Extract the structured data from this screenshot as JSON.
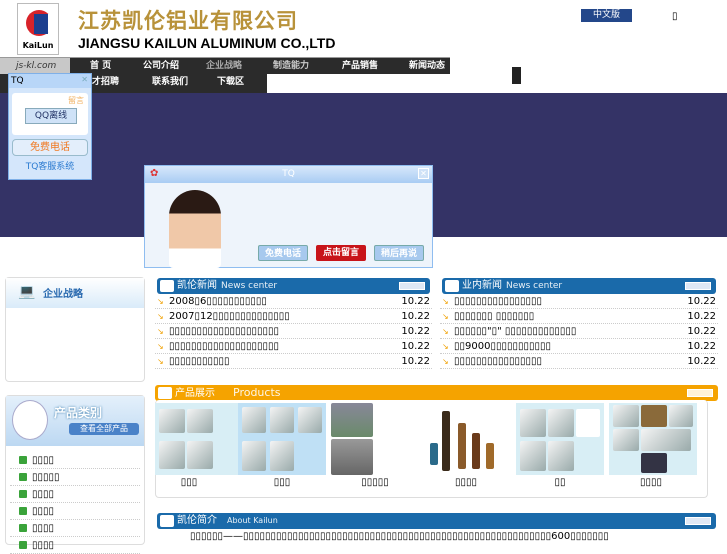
{
  "header": {
    "logo_text": "KaiLun",
    "title_cn": "江苏凯伦铝业有限公司",
    "title_en": "JIANGSU KAILUN ALUMINUM CO.,LTD",
    "lang_button": "中文版",
    "tofu": "▯"
  },
  "nav": {
    "site": "js-kl.com",
    "row1": [
      "首 页",
      "公司介绍",
      "企业战略",
      "制造能力",
      "产品销售",
      "新闻动态"
    ],
    "row2": [
      "才招聘",
      "联系我们",
      "下载区"
    ]
  },
  "tq_widget": {
    "title": "TQ",
    "leave_msg": "留言",
    "qq_button": "QQ离线",
    "phone_button": "免费电话",
    "footer": "TQ客服系统"
  },
  "tq_popup": {
    "title": "TQ",
    "buttons": [
      "免费电话",
      "点击留言",
      "稍后再说"
    ]
  },
  "left": {
    "strategy_title": "企业战略",
    "category_title": "产品类别",
    "view_all": "查看全部产品",
    "categories": [
      "▯▯▯▯",
      "▯▯▯▯▯",
      "▯▯▯▯",
      "▯▯▯▯",
      "▯▯▯▯",
      "▯▯▯▯"
    ]
  },
  "news_kailun": {
    "title": "凯伦新闻",
    "subtitle": "News center",
    "items": [
      {
        "t": "2008▯6▯▯▯▯▯▯▯▯▯▯▯",
        "d": "10.22"
      },
      {
        "t": "2007▯12▯▯▯▯▯▯▯▯▯▯▯▯▯▯",
        "d": "10.22"
      },
      {
        "t": "▯▯▯▯▯▯▯▯▯▯▯▯▯▯▯▯▯▯▯▯",
        "d": "10.22"
      },
      {
        "t": "▯▯▯▯▯▯▯▯▯▯▯▯▯▯▯▯▯▯▯▯",
        "d": "10.22"
      },
      {
        "t": "▯▯▯▯▯▯▯▯▯▯▯",
        "d": "10.22"
      }
    ]
  },
  "news_industry": {
    "title": "业内新闻",
    "subtitle": "News center",
    "items": [
      {
        "t": "▯▯▯▯▯▯▯▯▯▯▯▯▯▯▯▯",
        "d": "10.22"
      },
      {
        "t": "▯▯▯▯▯▯▯ ▯▯▯▯▯▯▯",
        "d": "10.22"
      },
      {
        "t": "▯▯▯▯▯▯\"▯\" ▯▯▯▯▯▯▯▯▯▯▯▯▯",
        "d": "10.22"
      },
      {
        "t": "▯▯9000▯▯▯▯▯▯▯▯▯▯▯",
        "d": "10.22"
      },
      {
        "t": "▯▯▯▯▯▯▯▯▯▯▯▯▯▯▯▯",
        "d": "10.22"
      }
    ]
  },
  "products": {
    "title": "产品展示",
    "subtitle": "Products",
    "labels": [
      "▯▯▯",
      "▯▯▯",
      "▯▯▯▯▯",
      "▯▯▯▯",
      "▯▯",
      "▯▯▯▯"
    ]
  },
  "about": {
    "title": "凯伦简介",
    "subtitle": "About Kailun",
    "text": "▯▯▯▯▯▯——▯▯▯▯▯▯▯▯▯▯▯▯▯▯▯▯▯▯▯▯▯▯▯▯▯▯▯▯▯▯▯▯▯▯▯▯▯▯▯▯▯▯▯▯▯▯▯▯▯▯▯▯▯▯▯▯600▯▯▯▯▯▯▯"
  },
  "colors": {
    "gold": "#b8923a",
    "banner": "#343366",
    "blue_bar": "#1a6aaa",
    "orange_bar": "#f5a300"
  }
}
